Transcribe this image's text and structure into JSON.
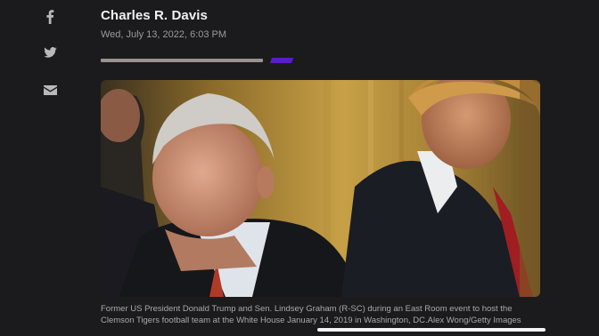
{
  "share": {
    "items": [
      {
        "name": "facebook-icon",
        "glyph": "f"
      },
      {
        "name": "twitter-icon",
        "glyph": "bird"
      },
      {
        "name": "email-icon",
        "glyph": "envelope"
      }
    ],
    "icon_color": "#b9b9bc"
  },
  "article": {
    "author": "Charles R. Davis",
    "timestamp": "Wed, July 13, 2022, 6:03 PM"
  },
  "photo": {
    "caption": "Former US President Donald Trump and Sen. Lindsey Graham (R-SC) during an East Room event to host the Clemson Tigers football team at the White House January 14, 2019 in Washington, DC.Alex Wong/Getty Images"
  },
  "colors": {
    "background": "#1b1b1d",
    "accent": "#5a1ec2",
    "divider": "#9a9190"
  }
}
